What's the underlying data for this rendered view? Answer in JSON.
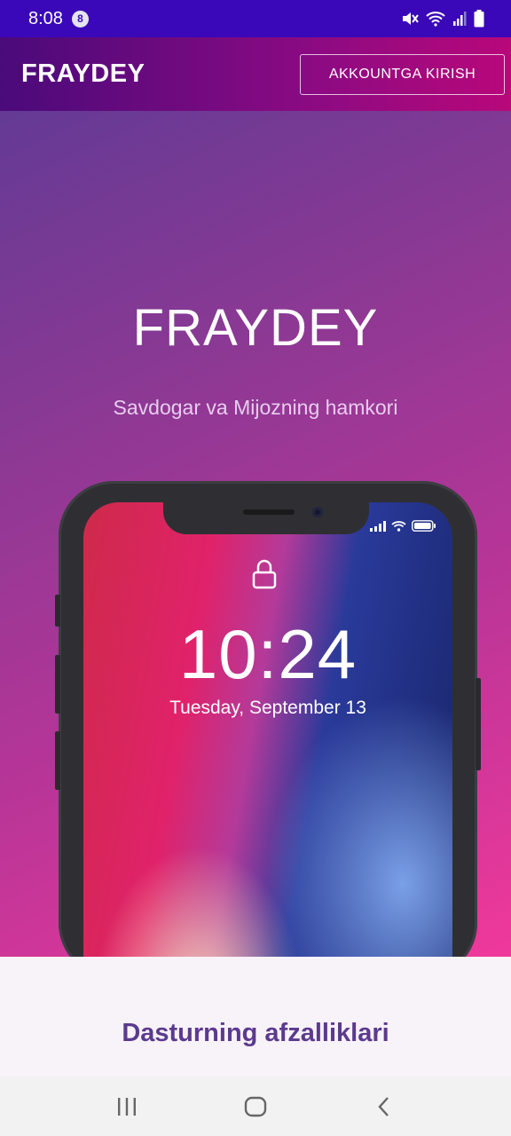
{
  "status_bar": {
    "time": "8:08",
    "notification_count": "8",
    "icons": [
      "mute-icon",
      "wifi-icon",
      "signal-icon",
      "battery-icon"
    ]
  },
  "app_bar": {
    "brand": "FRAYDEY",
    "login_label": "AKKOUNTGA KIRISH"
  },
  "hero": {
    "title": "FRAYDEY",
    "subtitle": "Savdogar va Mijozning hamkori"
  },
  "phone_mockup": {
    "time": "10:24",
    "date": "Tuesday, September 13",
    "icons": [
      "lock-icon",
      "signal-icon",
      "wifi-icon",
      "battery-icon"
    ]
  },
  "section": {
    "title": "Dasturning afzalliklari"
  },
  "nav_bar": {
    "icons": [
      "recents-icon",
      "home-icon",
      "back-icon"
    ]
  },
  "colors": {
    "status_bar": "#3a08b8",
    "section_title": "#5b3a8e",
    "lower_bg": "#f8f2f9"
  }
}
